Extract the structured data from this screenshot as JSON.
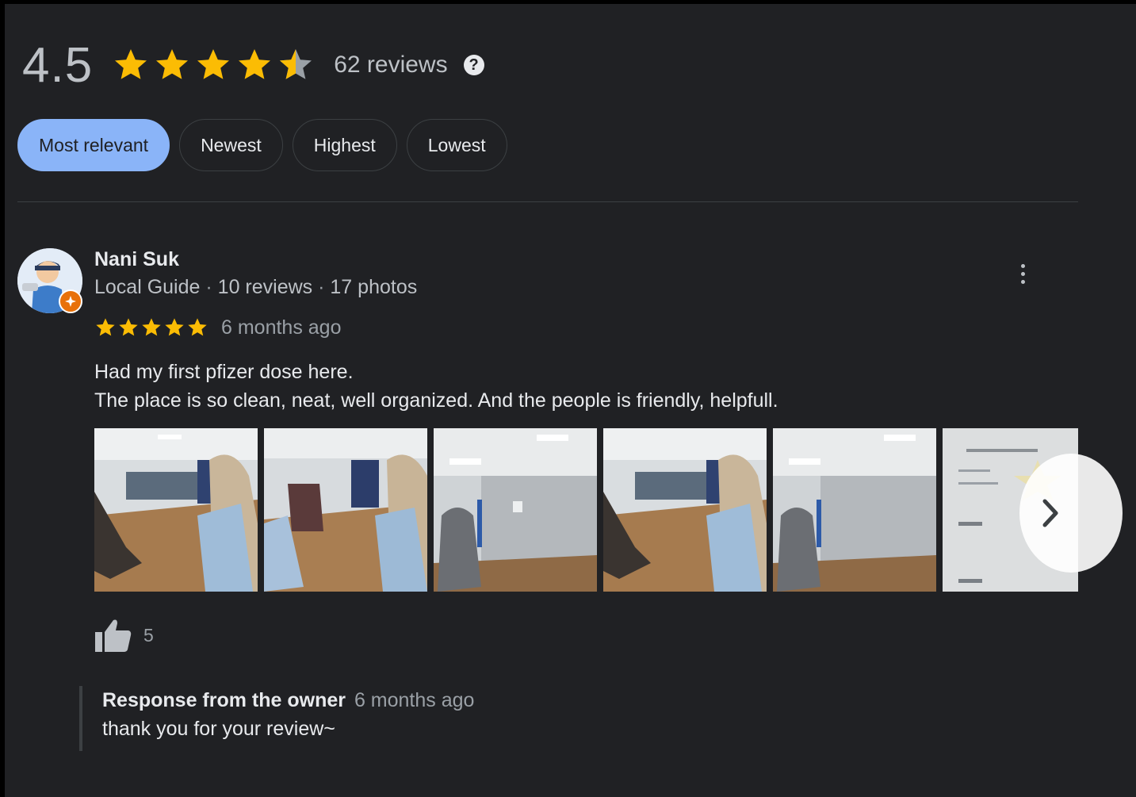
{
  "rating": {
    "average": "4.5",
    "average_value": 4.5,
    "max_stars": 5,
    "reviews_label": "62 reviews"
  },
  "sort_options": [
    {
      "label": "Most relevant",
      "active": true
    },
    {
      "label": "Newest",
      "active": false
    },
    {
      "label": "Highest",
      "active": false
    },
    {
      "label": "Lowest",
      "active": false
    }
  ],
  "review": {
    "author": "Nani Suk",
    "guide": "Local Guide",
    "reviews": "10 reviews",
    "photos": "17 photos",
    "separator": "·",
    "stars": 5,
    "time": "6 months ago",
    "text_line1": "Had my first pfizer dose here.",
    "text_line2": "The place is so clean, neat, well organized. And the people is friendly, helpfull.",
    "likes": "5"
  },
  "owner_response": {
    "title": "Response from the owner",
    "time": "6 months ago",
    "text": "thank you for your review~"
  },
  "colors": {
    "background": "#202124",
    "star": "#fbbc04",
    "active_chip": "#8ab4f8",
    "badge": "#e8710a"
  },
  "icons": [
    "help-icon",
    "more-vert-icon",
    "thumbs-up-icon",
    "chevron-right-icon"
  ]
}
